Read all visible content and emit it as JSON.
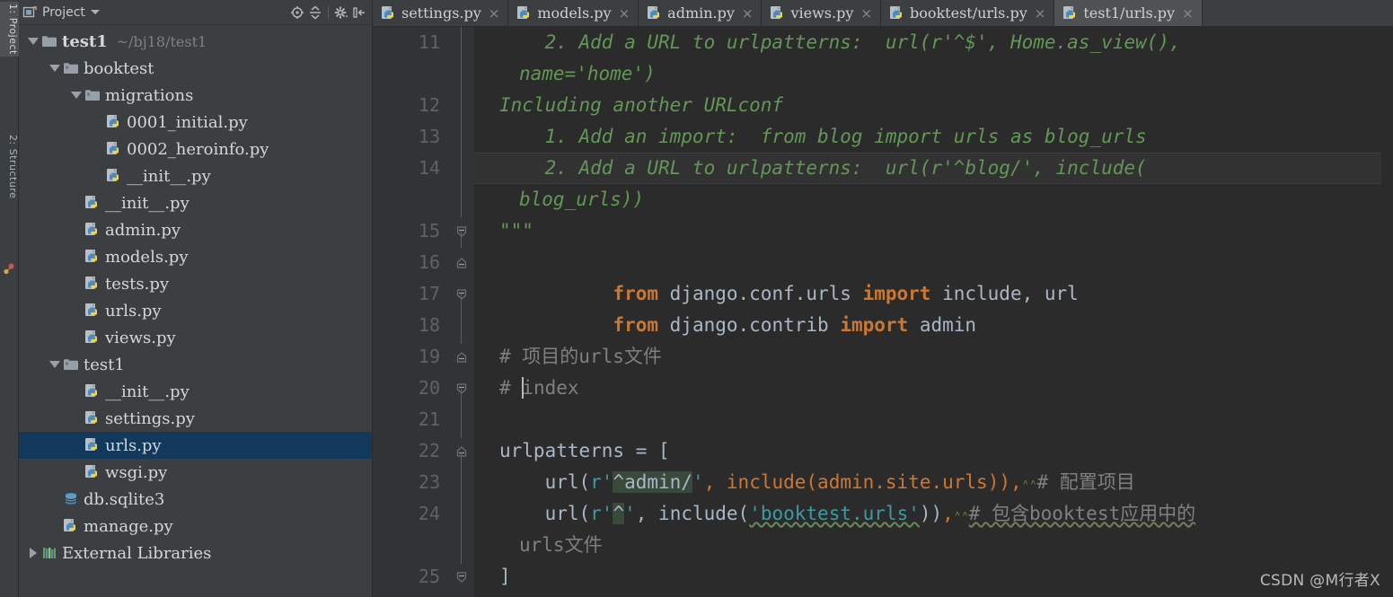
{
  "tool_window_bar": {
    "buttons": [
      {
        "label": "1: Project",
        "active": true
      },
      {
        "label": "2: Structure",
        "active": false
      }
    ],
    "marker_icon": "favorites-icon"
  },
  "project_panel": {
    "title": "Project",
    "title_dropdown_icon": "chevron-down-icon",
    "toolbar_icons": [
      {
        "name": "locate-target-icon",
        "glyph": "⊕"
      },
      {
        "name": "collapse-all-icon",
        "glyph": "÷"
      },
      {
        "name": "separator",
        "glyph": "|"
      },
      {
        "name": "gear-settings-icon",
        "glyph": "✿"
      },
      {
        "name": "hide-panel-icon",
        "glyph": "⇥"
      }
    ],
    "tree": [
      {
        "label": "test1",
        "note": "~/bj18/test1",
        "indent": 0,
        "twisty": "down",
        "icon": "folder-icon",
        "bold": true,
        "selected": false
      },
      {
        "label": "booktest",
        "note": "",
        "indent": 1,
        "twisty": "down",
        "icon": "folder-module-icon",
        "bold": false,
        "selected": false
      },
      {
        "label": "migrations",
        "note": "",
        "indent": 2,
        "twisty": "down",
        "icon": "folder-module-icon",
        "bold": false,
        "selected": false
      },
      {
        "label": "0001_initial.py",
        "note": "",
        "indent": 3,
        "twisty": "none",
        "icon": "python-file-icon",
        "bold": false,
        "selected": false
      },
      {
        "label": "0002_heroinfo.py",
        "note": "",
        "indent": 3,
        "twisty": "none",
        "icon": "python-file-icon",
        "bold": false,
        "selected": false
      },
      {
        "label": "__init__.py",
        "note": "",
        "indent": 3,
        "twisty": "none",
        "icon": "python-file-icon",
        "bold": false,
        "selected": false
      },
      {
        "label": "__init__.py",
        "note": "",
        "indent": 2,
        "twisty": "none",
        "icon": "python-file-icon",
        "bold": false,
        "selected": false
      },
      {
        "label": "admin.py",
        "note": "",
        "indent": 2,
        "twisty": "none",
        "icon": "python-file-icon",
        "bold": false,
        "selected": false
      },
      {
        "label": "models.py",
        "note": "",
        "indent": 2,
        "twisty": "none",
        "icon": "python-file-icon",
        "bold": false,
        "selected": false
      },
      {
        "label": "tests.py",
        "note": "",
        "indent": 2,
        "twisty": "none",
        "icon": "python-file-icon",
        "bold": false,
        "selected": false
      },
      {
        "label": "urls.py",
        "note": "",
        "indent": 2,
        "twisty": "none",
        "icon": "python-file-icon",
        "bold": false,
        "selected": false
      },
      {
        "label": "views.py",
        "note": "",
        "indent": 2,
        "twisty": "none",
        "icon": "python-file-icon",
        "bold": false,
        "selected": false
      },
      {
        "label": "test1",
        "note": "",
        "indent": 1,
        "twisty": "down",
        "icon": "folder-module-icon",
        "bold": false,
        "selected": false
      },
      {
        "label": "__init__.py",
        "note": "",
        "indent": 2,
        "twisty": "none",
        "icon": "python-file-icon",
        "bold": false,
        "selected": false
      },
      {
        "label": "settings.py",
        "note": "",
        "indent": 2,
        "twisty": "none",
        "icon": "python-file-icon",
        "bold": false,
        "selected": false
      },
      {
        "label": "urls.py",
        "note": "",
        "indent": 2,
        "twisty": "none",
        "icon": "python-file-icon",
        "bold": false,
        "selected": true
      },
      {
        "label": "wsgi.py",
        "note": "",
        "indent": 2,
        "twisty": "none",
        "icon": "python-file-icon",
        "bold": false,
        "selected": false
      },
      {
        "label": "db.sqlite3",
        "note": "",
        "indent": 1,
        "twisty": "none",
        "icon": "database-file-icon",
        "bold": false,
        "selected": false
      },
      {
        "label": "manage.py",
        "note": "",
        "indent": 1,
        "twisty": "none",
        "icon": "python-file-icon",
        "bold": false,
        "selected": false
      },
      {
        "label": "External Libraries",
        "note": "",
        "indent": 0,
        "twisty": "right",
        "icon": "libraries-icon",
        "bold": false,
        "selected": false
      }
    ]
  },
  "editor": {
    "tabs": [
      {
        "label": "settings.py",
        "icon": "python-file-icon",
        "active": false,
        "close": "×"
      },
      {
        "label": "models.py",
        "icon": "python-file-icon",
        "active": false,
        "close": "×"
      },
      {
        "label": "admin.py",
        "icon": "python-file-icon",
        "active": false,
        "close": "×"
      },
      {
        "label": "views.py",
        "icon": "python-file-icon",
        "active": false,
        "close": "×"
      },
      {
        "label": "booktest/urls.py",
        "icon": "python-file-icon",
        "active": false,
        "close": "×"
      },
      {
        "label": "test1/urls.py",
        "icon": "python-file-icon",
        "active": true,
        "close": "×"
      }
    ],
    "line_numbers": [
      "11",
      "12",
      "13",
      "14",
      "15",
      "16",
      "17",
      "18",
      "19",
      "20",
      "21",
      "22",
      "23",
      "24",
      "25"
    ],
    "code": {
      "l11a": "    2. Add a URL to urlpatterns:  url(r'^$', Home.as_view(),",
      "l11b": "name='home')",
      "l12": "Including another URLconf",
      "l13": "    1. Add an import:  from blog import urls as blog_urls",
      "l14a": "    2. Add a URL to urlpatterns:  url(r'^blog/', include(",
      "l14b": "blog_urls))",
      "l15": "\"\"\"",
      "l16_kw1": "from",
      "l16_mod": " django.conf.urls ",
      "l16_kw2": "import",
      "l16_rest": " include, url",
      "l17_kw1": "from",
      "l17_mod": " django.contrib ",
      "l17_kw2": "import",
      "l17_rest": " admin",
      "l19": "# 项目的urls文件",
      "l20_hash": "# ",
      "l20_text": "index",
      "l22": "urlpatterns = [",
      "l23_a": "    url(",
      "l23_r": "r'",
      "l23_re": "^admin/",
      "l23_q": "'",
      "l23_b": ", include(admin.site.urls))",
      "l23_comma": ",",
      "l23_cmt": "# 配置项目",
      "l24_a": "    url(",
      "l24_r": "r'",
      "l24_re": "^",
      "l24_q": "'",
      "l24_b": ", include(",
      "l24_s": "'booktest.urls'",
      "l24_c": "))",
      "l24_comma": ",",
      "l24_cmt": "# 包含booktest应用中的",
      "l24_cmt2": "urls文件",
      "l25": "]"
    }
  },
  "watermark": "CSDN @M行者X",
  "colors": {
    "panel_bg": "#3c3f41",
    "editor_bg": "#2b2b2b",
    "gutter_bg": "#313335",
    "selection": "#12395b",
    "keyword": "#cc7832",
    "comment_green": "#629755",
    "comment_gray": "#808080",
    "string": "#6a8759",
    "default_text": "#a9b7c6",
    "teal": "#3d9aa1",
    "tab_active": "#4e5254"
  }
}
